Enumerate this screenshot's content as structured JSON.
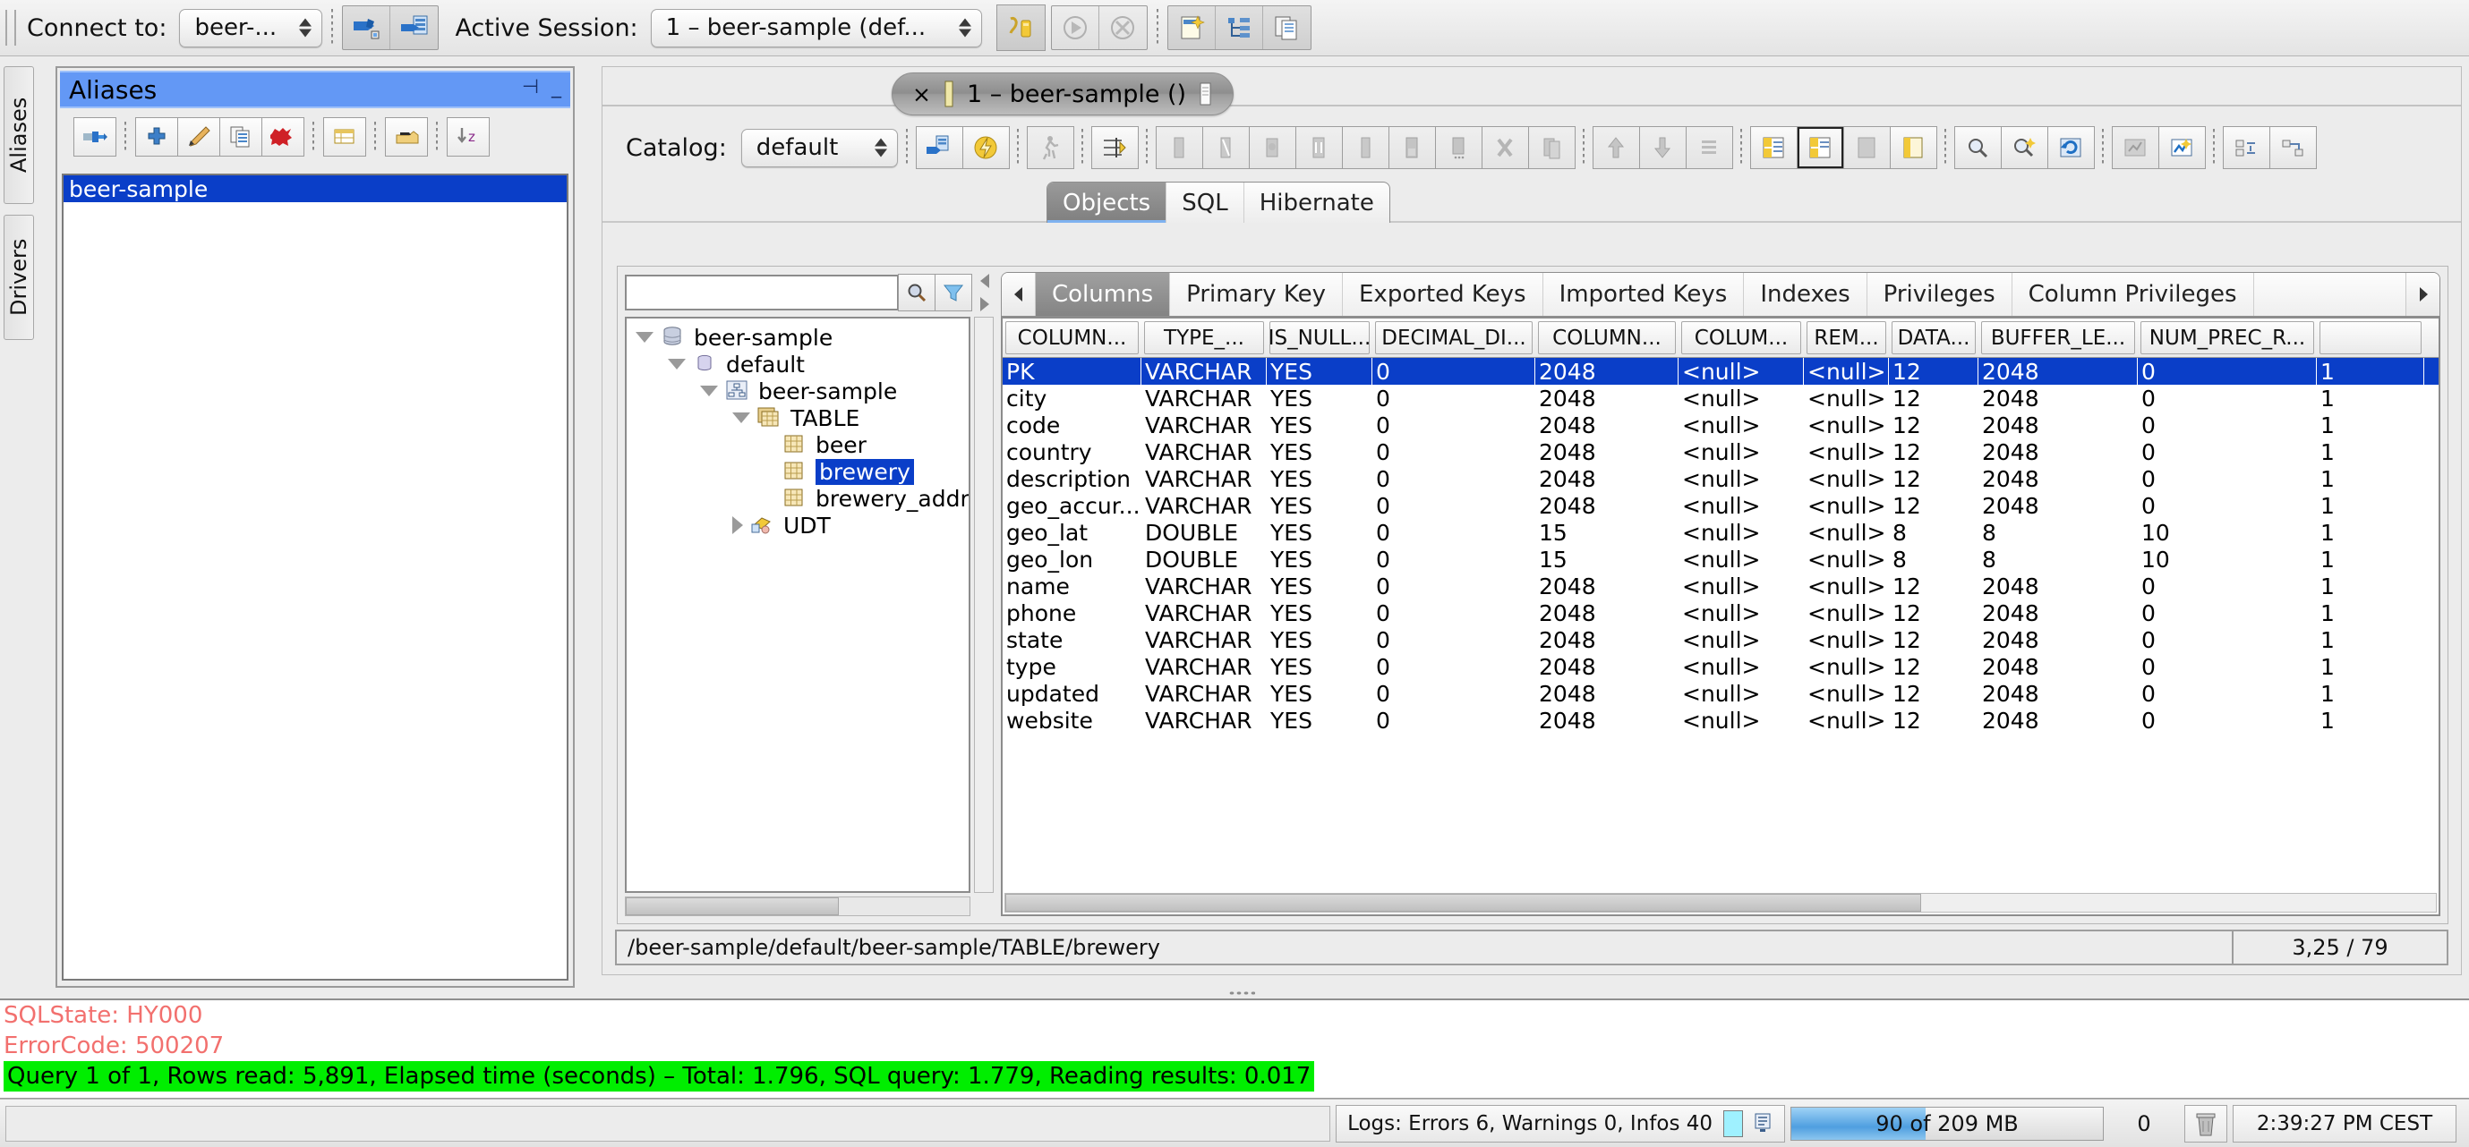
{
  "topbar": {
    "connect_label": "Connect to:",
    "connect_value": "beer-...",
    "active_session_label": "Active Session:",
    "active_session_value": "1 – beer-sample (def...",
    "buttons": [
      {
        "name": "connect-alias-icon",
        "title": "Connect"
      },
      {
        "name": "session-properties-icon",
        "title": "Session"
      },
      {
        "name": "commit-icon",
        "title": "Commit"
      },
      {
        "name": "execute-icon",
        "title": "Execute"
      },
      {
        "name": "cancel-icon",
        "title": "Cancel"
      },
      {
        "name": "new-session-icon",
        "title": "New Session"
      },
      {
        "name": "object-tree-icon",
        "title": "Object Tree"
      },
      {
        "name": "copy-session-icon",
        "title": "Copy Session"
      }
    ]
  },
  "vertical_tabs": [
    {
      "label": "Aliases"
    },
    {
      "label": "Drivers"
    }
  ],
  "aliases_panel": {
    "title": "Aliases",
    "float_glyph": "⊣",
    "minimize_glyph": "_",
    "toolbar": [
      {
        "name": "connect-icon"
      },
      {
        "name": "add-icon"
      },
      {
        "name": "modify-icon"
      },
      {
        "name": "copy-icon"
      },
      {
        "name": "delete-icon"
      },
      {
        "name": "new-folder-icon"
      },
      {
        "name": "paste-icon"
      },
      {
        "name": "sort-icon"
      }
    ],
    "items": [
      "beer-sample"
    ]
  },
  "main": {
    "doc_tab": {
      "close_glyph": "×",
      "label": "1 – beer-sample ()"
    },
    "catalog_label": "Catalog:",
    "catalog_value": "default",
    "toolbar_buttons": [
      {
        "name": "refresh-tree-icon"
      },
      {
        "name": "flash-icon"
      },
      {
        "name": "run-icon"
      },
      {
        "name": "filter-icon"
      },
      {
        "name": "paste-col-icon"
      },
      {
        "name": "edit-col-icon"
      },
      {
        "name": "open-icon"
      },
      {
        "name": "insert-icon"
      },
      {
        "name": "column-icon"
      },
      {
        "name": "store-icon"
      },
      {
        "name": "store-more-icon"
      },
      {
        "name": "delete-x-icon"
      },
      {
        "name": "duplicate-icon"
      },
      {
        "name": "move-up-icon"
      },
      {
        "name": "move-down-icon"
      },
      {
        "name": "list-icon"
      },
      {
        "name": "split-left-icon"
      },
      {
        "name": "split-right-icon"
      },
      {
        "name": "dock-icon"
      },
      {
        "name": "undock-icon"
      },
      {
        "name": "zoom-icon"
      },
      {
        "name": "search-right-icon"
      },
      {
        "name": "refresh-data-icon"
      },
      {
        "name": "chart-icon"
      },
      {
        "name": "graph-icon"
      },
      {
        "name": "expand-icon"
      },
      {
        "name": "collapse-icon"
      }
    ],
    "tabs": [
      {
        "label": "Objects",
        "selected": true
      },
      {
        "label": "SQL",
        "selected": false
      },
      {
        "label": "Hibernate",
        "selected": false
      }
    ],
    "subtabs": [
      {
        "label": "Columns",
        "selected": true
      },
      {
        "label": "Primary Key",
        "selected": false
      },
      {
        "label": "Exported Keys",
        "selected": false
      },
      {
        "label": "Imported Keys",
        "selected": false
      },
      {
        "label": "Indexes",
        "selected": false
      },
      {
        "label": "Privileges",
        "selected": false
      },
      {
        "label": "Column Privileges",
        "selected": false
      }
    ],
    "filter": {
      "value": "",
      "placeholder": ""
    },
    "tree": [
      {
        "label": "beer-sample",
        "depth": 0,
        "toggle": "down",
        "icon": "database-icon",
        "selected": false
      },
      {
        "label": "default",
        "depth": 1,
        "toggle": "down",
        "icon": "catalog-icon",
        "selected": false
      },
      {
        "label": "beer-sample",
        "depth": 2,
        "toggle": "down",
        "icon": "schema-icon",
        "selected": false
      },
      {
        "label": "TABLE",
        "depth": 3,
        "toggle": "down",
        "icon": "tables-icon",
        "selected": false
      },
      {
        "label": "beer",
        "depth": 4,
        "toggle": "none",
        "icon": "table-icon",
        "selected": false
      },
      {
        "label": "brewery",
        "depth": 4,
        "toggle": "none",
        "icon": "table-icon",
        "selected": true
      },
      {
        "label": "brewery_addr",
        "depth": 4,
        "toggle": "none",
        "icon": "table-icon",
        "selected": false
      },
      {
        "label": "UDT",
        "depth": 3,
        "toggle": "right",
        "icon": "udt-icon",
        "selected": false
      }
    ],
    "grid": {
      "headers": [
        "COLUMN...",
        "TYPE_...",
        "IS_NULL...",
        "DECIMAL_DI...",
        "COLUMN...",
        "COLUM...",
        "REM...",
        "DATA...",
        "BUFFER_LE...",
        "NUM_PREC_R...",
        ""
      ],
      "rows": [
        {
          "selected": true,
          "cells": [
            "PK",
            "VARCHAR",
            "YES",
            "0",
            "2048",
            "<null>",
            "<null>",
            "12",
            "2048",
            "0",
            "1"
          ]
        },
        {
          "selected": false,
          "cells": [
            "city",
            "VARCHAR",
            "YES",
            "0",
            "2048",
            "<null>",
            "<null>",
            "12",
            "2048",
            "0",
            "1"
          ]
        },
        {
          "selected": false,
          "cells": [
            "code",
            "VARCHAR",
            "YES",
            "0",
            "2048",
            "<null>",
            "<null>",
            "12",
            "2048",
            "0",
            "1"
          ]
        },
        {
          "selected": false,
          "cells": [
            "country",
            "VARCHAR",
            "YES",
            "0",
            "2048",
            "<null>",
            "<null>",
            "12",
            "2048",
            "0",
            "1"
          ]
        },
        {
          "selected": false,
          "cells": [
            "description",
            "VARCHAR",
            "YES",
            "0",
            "2048",
            "<null>",
            "<null>",
            "12",
            "2048",
            "0",
            "1"
          ]
        },
        {
          "selected": false,
          "cells": [
            "geo_accur...",
            "VARCHAR",
            "YES",
            "0",
            "2048",
            "<null>",
            "<null>",
            "12",
            "2048",
            "0",
            "1"
          ]
        },
        {
          "selected": false,
          "cells": [
            "geo_lat",
            "DOUBLE",
            "YES",
            "0",
            "15",
            "<null>",
            "<null>",
            "8",
            "8",
            "10",
            "1"
          ]
        },
        {
          "selected": false,
          "cells": [
            "geo_lon",
            "DOUBLE",
            "YES",
            "0",
            "15",
            "<null>",
            "<null>",
            "8",
            "8",
            "10",
            "1"
          ]
        },
        {
          "selected": false,
          "cells": [
            "name",
            "VARCHAR",
            "YES",
            "0",
            "2048",
            "<null>",
            "<null>",
            "12",
            "2048",
            "0",
            "1"
          ]
        },
        {
          "selected": false,
          "cells": [
            "phone",
            "VARCHAR",
            "YES",
            "0",
            "2048",
            "<null>",
            "<null>",
            "12",
            "2048",
            "0",
            "1"
          ]
        },
        {
          "selected": false,
          "cells": [
            "state",
            "VARCHAR",
            "YES",
            "0",
            "2048",
            "<null>",
            "<null>",
            "12",
            "2048",
            "0",
            "1"
          ]
        },
        {
          "selected": false,
          "cells": [
            "type",
            "VARCHAR",
            "YES",
            "0",
            "2048",
            "<null>",
            "<null>",
            "12",
            "2048",
            "0",
            "1"
          ]
        },
        {
          "selected": false,
          "cells": [
            "updated",
            "VARCHAR",
            "YES",
            "0",
            "2048",
            "<null>",
            "<null>",
            "12",
            "2048",
            "0",
            "1"
          ]
        },
        {
          "selected": false,
          "cells": [
            "website",
            "VARCHAR",
            "YES",
            "0",
            "2048",
            "<null>",
            "<null>",
            "12",
            "2048",
            "0",
            "1"
          ]
        }
      ]
    },
    "path": "/beer-sample/default/beer-sample/TABLE/brewery",
    "path_counter": "3,25 / 79"
  },
  "log": {
    "lines": [
      {
        "text": "SQLState:  HY000",
        "style": "err"
      },
      {
        "text": "ErrorCode: 500207",
        "style": "err"
      },
      {
        "text": "Query 1 of 1, Rows read: 5,891, Elapsed time (seconds) – Total: 1.796, SQL query: 1.779, Reading results: 0.017",
        "style": "ok"
      }
    ]
  },
  "statusbar": {
    "logs_text": "Logs: Errors 6, Warnings 0, Infos 40",
    "memory_text": "90 of 209 MB",
    "memory_percent": 43,
    "counter": "0",
    "clock": "2:39:27 PM CEST"
  },
  "colors": {
    "selection_blue": "#0a3ec8",
    "title_blue": "#6398f5",
    "error_red": "#f2706e",
    "success_green": "#00ee00"
  }
}
